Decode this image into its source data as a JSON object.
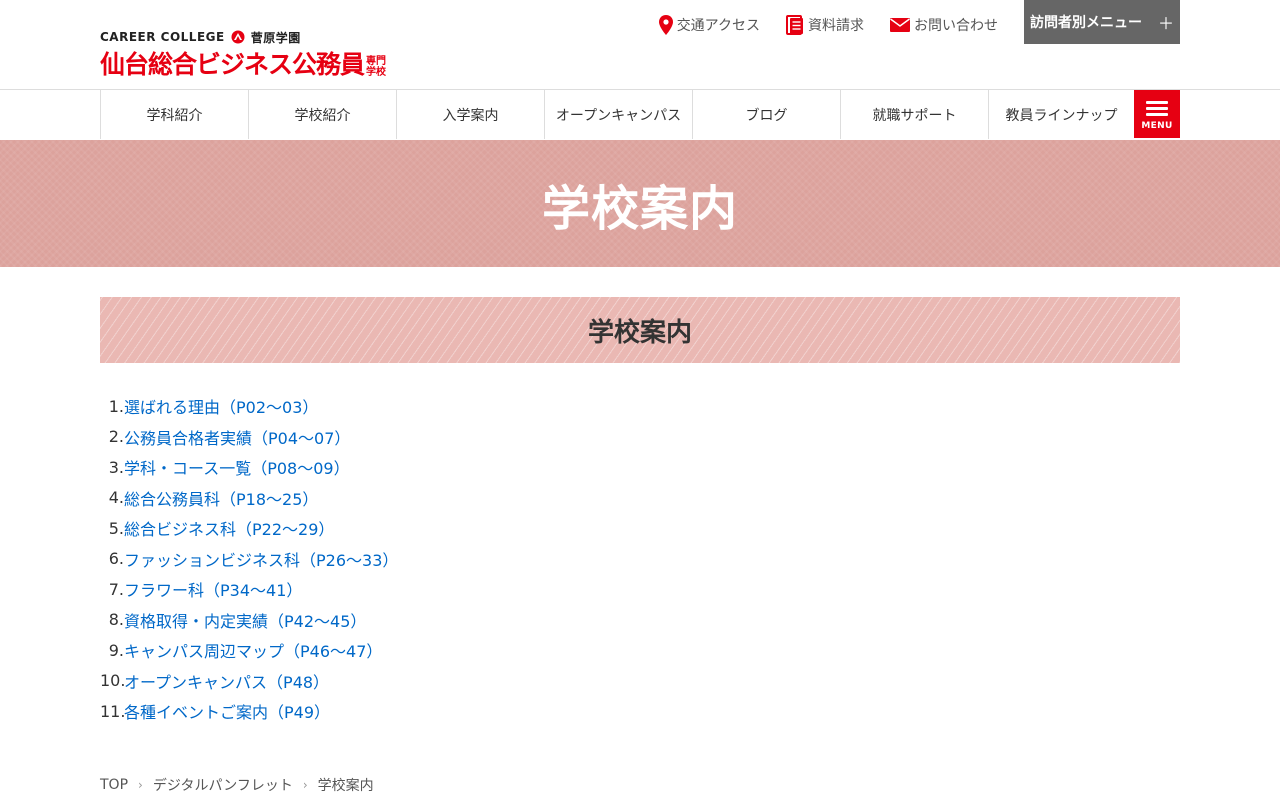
{
  "logo": {
    "small": "CAREER COLLEGE",
    "group": "菅原学園",
    "title": "仙台総合ビジネス公務員",
    "sub1": "専門",
    "sub2": "学校"
  },
  "utility": {
    "access": "交通アクセス",
    "brochure": "資料請求",
    "contact": "お問い合わせ",
    "visitor_menu": "訪問者別メニュー",
    "visitor_plus": "＋"
  },
  "gnav": [
    "学科紹介",
    "学校紹介",
    "入学案内",
    "オープンキャンパス",
    "ブログ",
    "就職サポート",
    "教員ラインナップ"
  ],
  "menu_label": "MENU",
  "hero_title": "学校案内",
  "section_title": "学校案内",
  "toc": [
    {
      "num": "1.",
      "label": "選ばれる理由（P02〜03）"
    },
    {
      "num": "2.",
      "label": "公務員合格者実績（P04〜07）"
    },
    {
      "num": "3.",
      "label": "学科・コース一覧（P08〜09）"
    },
    {
      "num": "4.",
      "label": "総合公務員科（P18〜25）"
    },
    {
      "num": "5.",
      "label": "総合ビジネス科（P22〜29）"
    },
    {
      "num": "6.",
      "label": "ファッションビジネス科（P26〜33）"
    },
    {
      "num": "7.",
      "label": "フラワー科（P34〜41）"
    },
    {
      "num": "8.",
      "label": "資格取得・内定実績（P42〜45）"
    },
    {
      "num": "9.",
      "label": "キャンパス周辺マップ（P46〜47）"
    },
    {
      "num": "10.",
      "label": "オープンキャンパス（P48）"
    },
    {
      "num": "11.",
      "label": "各種イベントご案内（P49）"
    }
  ],
  "breadcrumb": {
    "home": "TOP",
    "level1": "デジタルパンフレット",
    "current": "学校案内",
    "sep": "›"
  },
  "colors": {
    "brand_red": "#e60012",
    "link_blue": "#0068c8",
    "hero_bg": "#dca29c",
    "section_bg": "#eab8b3"
  }
}
